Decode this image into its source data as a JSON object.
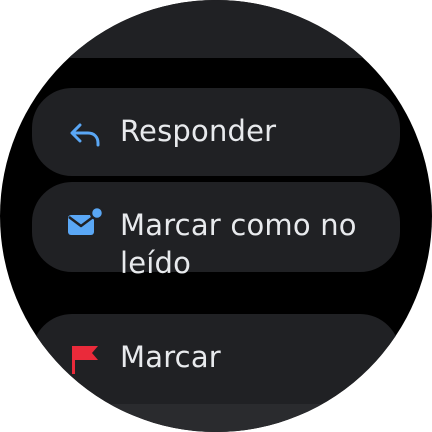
{
  "actions": {
    "reply": {
      "label": "Responder",
      "icon": "reply-icon",
      "icon_color": "#5aa7f5"
    },
    "mark_unread": {
      "label": "Marcar como no leído",
      "icon": "mail-unread-icon",
      "icon_color": "#5aa7f5"
    },
    "flag": {
      "label": "Marcar",
      "icon": "flag-icon",
      "icon_color": "#ea2a3a"
    }
  },
  "colors": {
    "background": "#000000",
    "chip": "#202124",
    "text": "#e8eaed"
  }
}
